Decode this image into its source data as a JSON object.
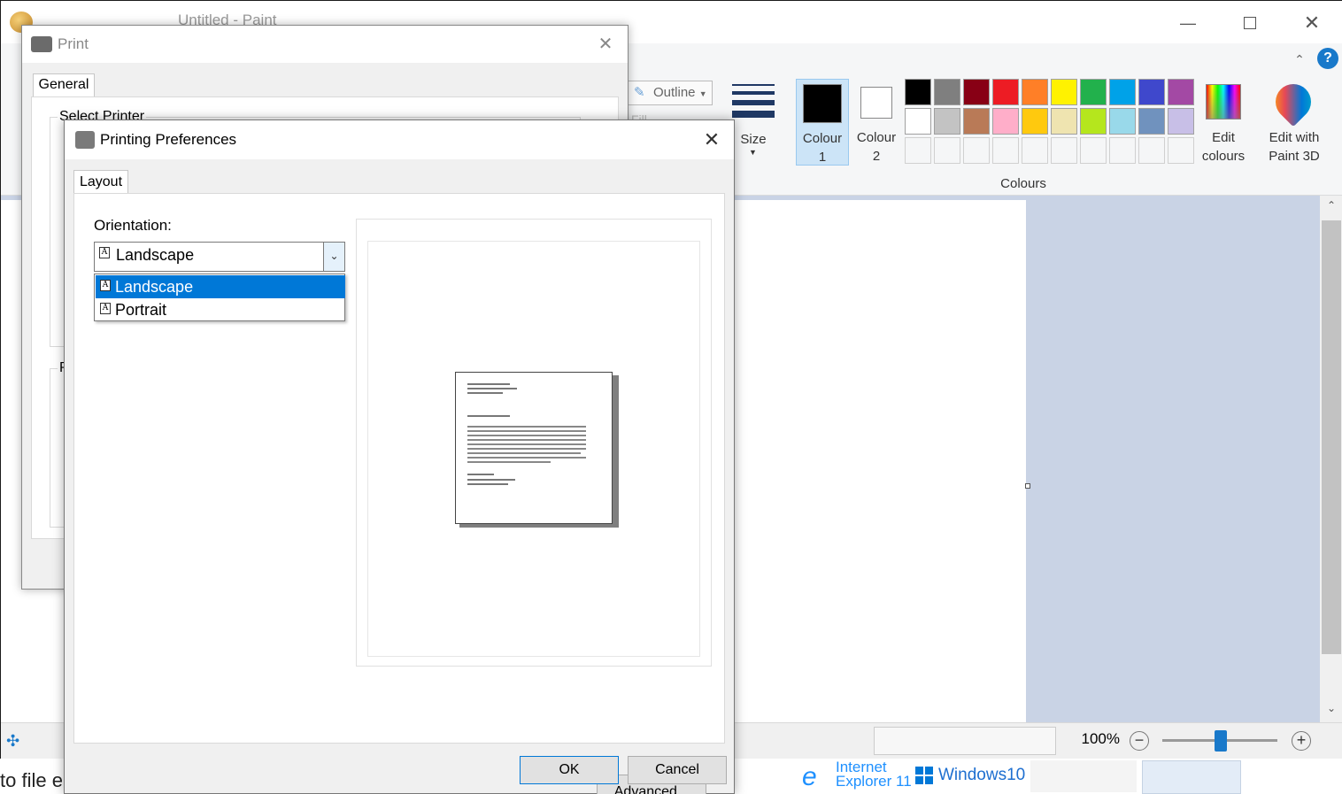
{
  "paint": {
    "title": "Untitled - Paint",
    "ribbon": {
      "outline_label": "Outline",
      "fill_label": "Fill",
      "size_label": "Size",
      "colour1_label": "Colour\n1",
      "colour2_label": "Colour\n2",
      "edit_colours_label": "Edit\ncolours",
      "paint3d_label": "Edit with\nPaint 3D",
      "colours_group_label": "Colours",
      "palette_row1": [
        "#000000",
        "#7f7f7f",
        "#880015",
        "#ed1c24",
        "#ff7f27",
        "#fff200",
        "#22b14c",
        "#00a2e8",
        "#3f48cc",
        "#a349a4"
      ],
      "palette_row2": [
        "#ffffff",
        "#c3c3c3",
        "#b97a57",
        "#ffaec9",
        "#ffc90e",
        "#efe4b0",
        "#b5e61d",
        "#99d9ea",
        "#7092be",
        "#c8bfe7"
      ],
      "colour1": "#000000",
      "colour2": "#ffffff"
    },
    "status": {
      "zoom": "100%"
    }
  },
  "print_dialog": {
    "title": "Print",
    "tab": "General",
    "partial_label_1": "Select Printer",
    "partial_label_2": "P"
  },
  "prefs_dialog": {
    "title": "Printing Preferences",
    "tab": "Layout",
    "orientation_label": "Orientation:",
    "orientation_value": "Landscape",
    "orientation_options": [
      "Landscape",
      "Portrait"
    ],
    "advanced_button": "Advanced...",
    "ok_button": "OK",
    "cancel_button": "Cancel"
  },
  "taskbar_strip": {
    "left_text": "to file e",
    "ie_label_1": "Internet",
    "ie_label_2": "Explorer 11",
    "win_label": "Windows10"
  }
}
